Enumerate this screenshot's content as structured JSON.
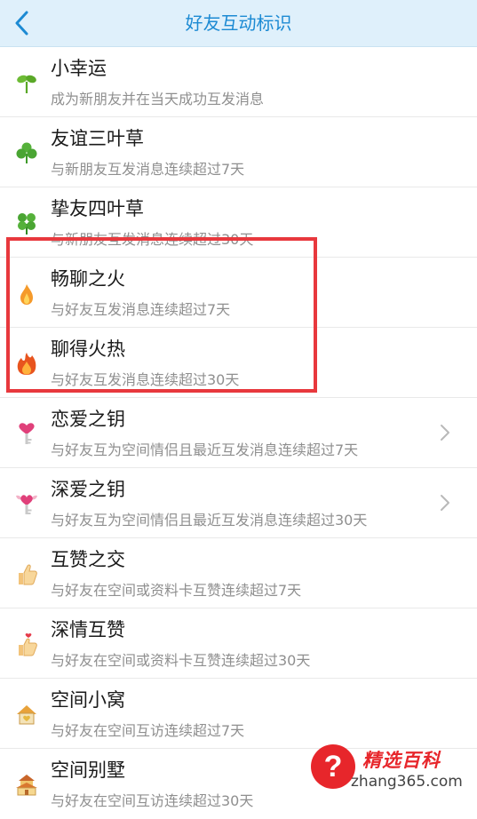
{
  "header": {
    "title": "好友互动标识",
    "back_icon": "chevron-left-icon"
  },
  "items": [
    {
      "title": "小幸运",
      "desc": "成为新朋友并在当天成功互发消息",
      "icon": "sprout-icon"
    },
    {
      "title": "友谊三叶草",
      "desc": "与新朋友互发消息连续超过7天",
      "icon": "three-leaf-clover-icon"
    },
    {
      "title": "挚友四叶草",
      "desc": "与新朋友互发消息连续超过30天",
      "icon": "four-leaf-clover-icon"
    },
    {
      "title": "畅聊之火",
      "desc": "与好友互发消息连续超过7天",
      "icon": "small-flame-icon"
    },
    {
      "title": "聊得火热",
      "desc": "与好友互发消息连续超过30天",
      "icon": "big-flame-icon"
    },
    {
      "title": "恋爱之钥",
      "desc": "与好友互为空间情侣且最近互发消息连续超过7天",
      "icon": "heart-key-icon"
    },
    {
      "title": "深爱之钥",
      "desc": "与好友互为空间情侣且最近互发消息连续超过30天",
      "icon": "winged-heart-key-icon"
    },
    {
      "title": "互赞之交",
      "desc": "与好友在空间或资料卡互赞连续超过7天",
      "icon": "thumbs-up-icon"
    },
    {
      "title": "深情互赞",
      "desc": "与好友在空间或资料卡互赞连续超过30天",
      "icon": "heart-thumbs-up-icon"
    },
    {
      "title": "空间小窝",
      "desc": "与好友在空间互访连续超过7天",
      "icon": "small-house-icon"
    },
    {
      "title": "空间别墅",
      "desc": "与好友在空间互访连续超过30天",
      "icon": "villa-icon"
    }
  ],
  "watermark": {
    "mark": "?",
    "name": "精选百科",
    "url": "zhang365.com"
  },
  "colors": {
    "nav_bg": "#dff0fb",
    "nav_title": "#1c8ad3",
    "highlight_border": "#e8383d",
    "desc_text": "#8f8f8f"
  }
}
